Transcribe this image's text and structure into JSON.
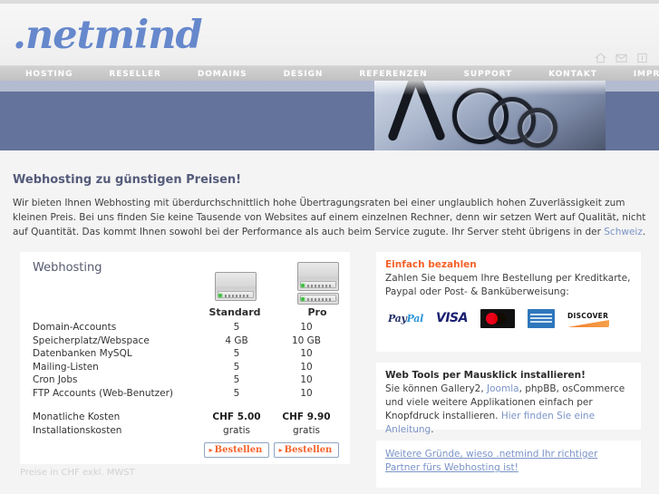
{
  "brand": {
    "logo_text": ".netmind"
  },
  "top_icons": [
    {
      "name": "home-icon",
      "label": "Home"
    },
    {
      "name": "mail-icon",
      "label": "Kontakt"
    },
    {
      "name": "info-box-icon",
      "label": "Info"
    }
  ],
  "nav": {
    "items": [
      {
        "label": "HOSTING"
      },
      {
        "label": "RESELLER"
      },
      {
        "label": "DOMAINS"
      },
      {
        "label": "DESIGN"
      },
      {
        "label": "REFERENZEN"
      },
      {
        "label": "SUPPORT"
      },
      {
        "label": "KONTAKT"
      },
      {
        "label": "IMPRESSUM"
      }
    ]
  },
  "main": {
    "heading": "Webhosting zu günstigen Preisen!",
    "intro_part1": "Wir bieten Ihnen Webhosting mit überdurchschnittlich hohe Übertragungsraten bei einer unglaublich hohen Zuverlässigkeit zum kleinen Preis. Bei uns finden Sie keine Tausende von Websites auf einem einzelnen Rechner, denn wir setzen Wert auf Qualität, nicht auf Quantität. Das kommt Ihnen sowohl bei der Performance als auch beim Service zugute. Ihr Server steht übrigens in der ",
    "intro_link": "Schweiz",
    "intro_part2": "."
  },
  "table": {
    "title": "Webhosting",
    "columns": [
      {
        "label": "Standard"
      },
      {
        "label": "Pro"
      }
    ],
    "rows": [
      {
        "label": "Domain-Accounts",
        "standard": "5",
        "pro": "10"
      },
      {
        "label": "Speicherplatz/Webspace",
        "standard": "4 GB",
        "pro": "10 GB"
      },
      {
        "label": "Datenbanken MySQL",
        "standard": "5",
        "pro": "10"
      },
      {
        "label": "Mailing-Listen",
        "standard": "5",
        "pro": "10"
      },
      {
        "label": "Cron Jobs",
        "standard": "5",
        "pro": "10"
      },
      {
        "label": "FTP Accounts (Web-Benutzer)",
        "standard": "5",
        "pro": "10"
      }
    ],
    "price_rows": [
      {
        "label": "Monatliche Kosten",
        "standard": "CHF 5.00",
        "pro": "CHF 9.90",
        "bold": true
      },
      {
        "label": "Installationskosten",
        "standard": "gratis",
        "pro": "gratis",
        "bold": false
      }
    ],
    "order_button_label": "Bestellen",
    "footnote": "Preise in CHF exkl. MWST"
  },
  "sidebar": {
    "pay": {
      "heading": "Einfach bezahlen",
      "text": "Zahlen Sie bequem Ihre Bestellung per Kreditkarte, Paypal oder Post- & Banküberweisung:",
      "cards": [
        {
          "name": "paypal-logo",
          "label": "PayPal"
        },
        {
          "name": "visa-logo",
          "label": "VISA"
        },
        {
          "name": "mastercard-logo",
          "label": "MasterCard"
        },
        {
          "name": "amex-logo",
          "label": "American Express"
        },
        {
          "name": "discover-logo",
          "label": "DISCOVER"
        }
      ]
    },
    "tools": {
      "heading": "Web Tools per Mausklick installieren!",
      "text_part1": "Sie können Gallery2, ",
      "link1": "Joomla",
      "text_part2": ", phpBB, osCommerce und viele weitere Applikationen einfach per Knopfdruck installieren. ",
      "link2": "Hier finden Sie eine Anleitung",
      "text_part3": "."
    },
    "reasons": {
      "link": "Weitere Gründe, wieso .netmind Ihr richtiger Partner fürs Webhosting ist!"
    }
  },
  "colors": {
    "logo_blue": "#6688cc",
    "banner_blue": "#64739b",
    "nav_gray": "#c9c9c9",
    "accent_orange": "#f4622a",
    "link_blue": "#7b93c7",
    "heading_slate": "#545b7a"
  }
}
